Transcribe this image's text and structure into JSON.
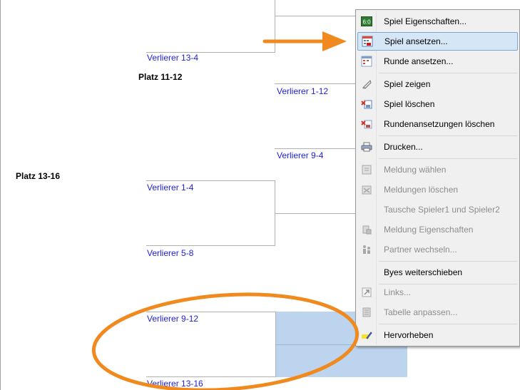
{
  "bracket": {
    "labels": {
      "l13_4": "Verlierer  13-4",
      "l1_12": "Verlierer  1-12",
      "l9_4": "Verlierer  9-4",
      "l1_4": "Verlierer  1-4",
      "l5_8": "Verlierer  5-8",
      "l9_12": "Verlierer  9-12",
      "l13_16": "Verlierer  13-16"
    },
    "sections": {
      "platz_11_12": "Platz 11-12",
      "platz_13_16": "Platz 13-16"
    }
  },
  "context_menu": {
    "items": [
      {
        "label": "Spiel Eigenschaften...",
        "icon": "match-properties-icon",
        "enabled": true
      },
      {
        "label": "Spiel ansetzen...",
        "icon": "schedule-match-icon",
        "enabled": true,
        "selected": true
      },
      {
        "label": "Runde ansetzen...",
        "icon": "schedule-round-icon",
        "enabled": true
      },
      {
        "label": "Spiel zeigen",
        "icon": "show-match-icon",
        "enabled": true
      },
      {
        "label": "Spiel löschen",
        "icon": "delete-match-icon",
        "enabled": true
      },
      {
        "label": "Rundenansetzungen löschen",
        "icon": "delete-round-schedule-icon",
        "enabled": true
      },
      {
        "label": "Drucken...",
        "icon": "printer-icon",
        "enabled": true
      },
      {
        "label": "Meldung wählen",
        "icon": "select-entry-icon",
        "enabled": false
      },
      {
        "label": "Meldungen löschen",
        "icon": "delete-entries-icon",
        "enabled": false
      },
      {
        "label": "Tausche Spieler1 und Spieler2",
        "icon": "",
        "enabled": false
      },
      {
        "label": "Meldung Eigenschaften",
        "icon": "entry-properties-icon",
        "enabled": false
      },
      {
        "label": "Partner wechseln...",
        "icon": "swap-partner-icon",
        "enabled": false
      },
      {
        "label": "Byes weiterschieben",
        "icon": "",
        "enabled": true
      },
      {
        "label": "Links...",
        "icon": "link-icon",
        "enabled": false
      },
      {
        "label": "Tabelle anpassen...",
        "icon": "table-icon",
        "enabled": false
      },
      {
        "label": "Hervorheben",
        "icon": "highlight-icon",
        "enabled": true
      }
    ]
  },
  "colors": {
    "accent_annotation": "#f08a1e",
    "selection": "#bcd4ee",
    "link_text": "#2020e0"
  }
}
